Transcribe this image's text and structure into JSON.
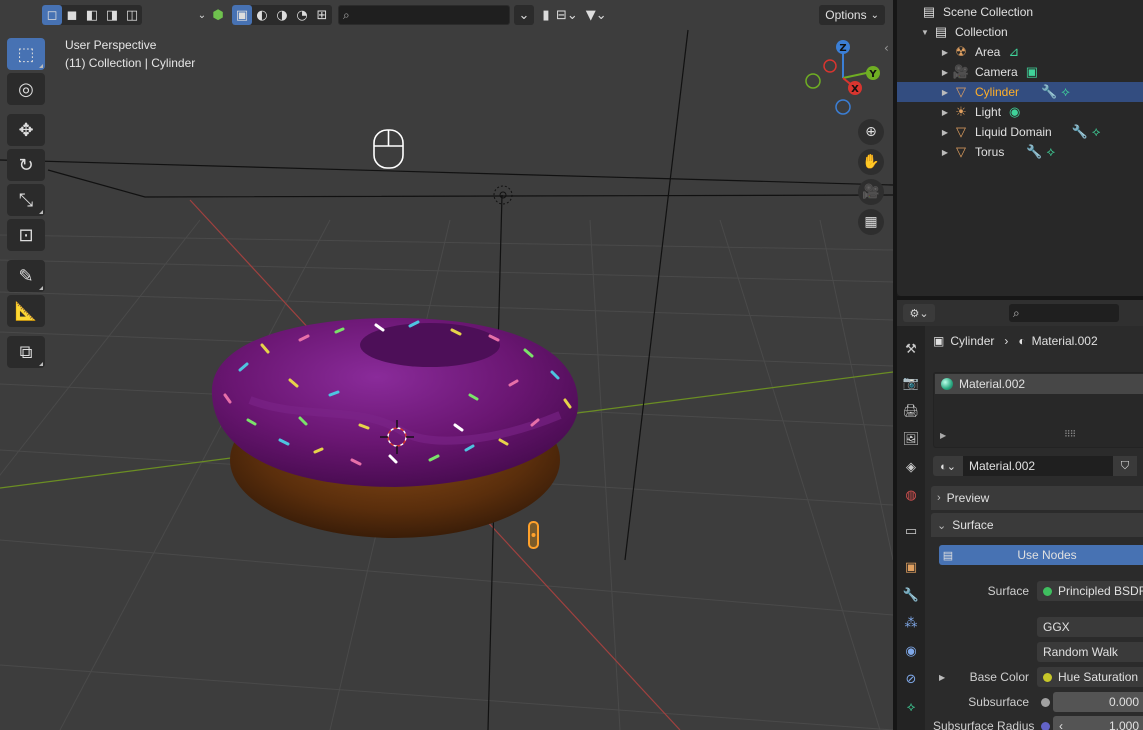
{
  "viewport": {
    "mode_label": "User Perspective",
    "collection_label": "(11) Collection | Cylinder",
    "search_placeholder": "",
    "options_label": "Options",
    "gizmo": {
      "z": "Z",
      "y": "Y",
      "x": "X"
    },
    "colors": {
      "background": "#3d3d3d",
      "grid": "#4a4a4a",
      "x_axis": "#a0413f",
      "y_axis": "#6b8e23",
      "active_tool": "#4772b3"
    }
  },
  "toolbar": {
    "tools": [
      "select-box",
      "cursor",
      "move",
      "rotate",
      "scale",
      "transform",
      "annotate",
      "measure",
      "add-cube"
    ]
  },
  "outliner": {
    "root": "Scene Collection",
    "collection": "Collection",
    "items": [
      {
        "label": "Area",
        "icon": "area-light-icon",
        "selected": false
      },
      {
        "label": "Camera",
        "icon": "camera-icon",
        "selected": false
      },
      {
        "label": "Cylinder",
        "icon": "mesh-icon",
        "selected": true
      },
      {
        "label": "Light",
        "icon": "light-icon",
        "selected": false
      },
      {
        "label": "Liquid Domain",
        "icon": "mesh-icon",
        "selected": false
      },
      {
        "label": "Torus",
        "icon": "mesh-icon",
        "selected": false
      }
    ]
  },
  "properties": {
    "search_placeholder": "",
    "breadcrumb": {
      "object": "Cylinder",
      "material": "Material.002"
    },
    "slot": {
      "name": "Material.002"
    },
    "material_name": "Material.002",
    "panels": {
      "preview": "Preview",
      "surface": "Surface"
    },
    "use_nodes": "Use Nodes",
    "rows": {
      "surface_label": "Surface",
      "surface_value": "Principled BSDF",
      "distribution": "GGX",
      "subsurface_method": "Random Walk",
      "base_color_label": "Base Color",
      "base_color_value": "Hue Saturation",
      "subsurface_label": "Subsurface",
      "subsurface_value": "0.000",
      "subsurface_radius_label": "Subsurface Radius",
      "subsurface_radius_value": "1.000"
    }
  }
}
